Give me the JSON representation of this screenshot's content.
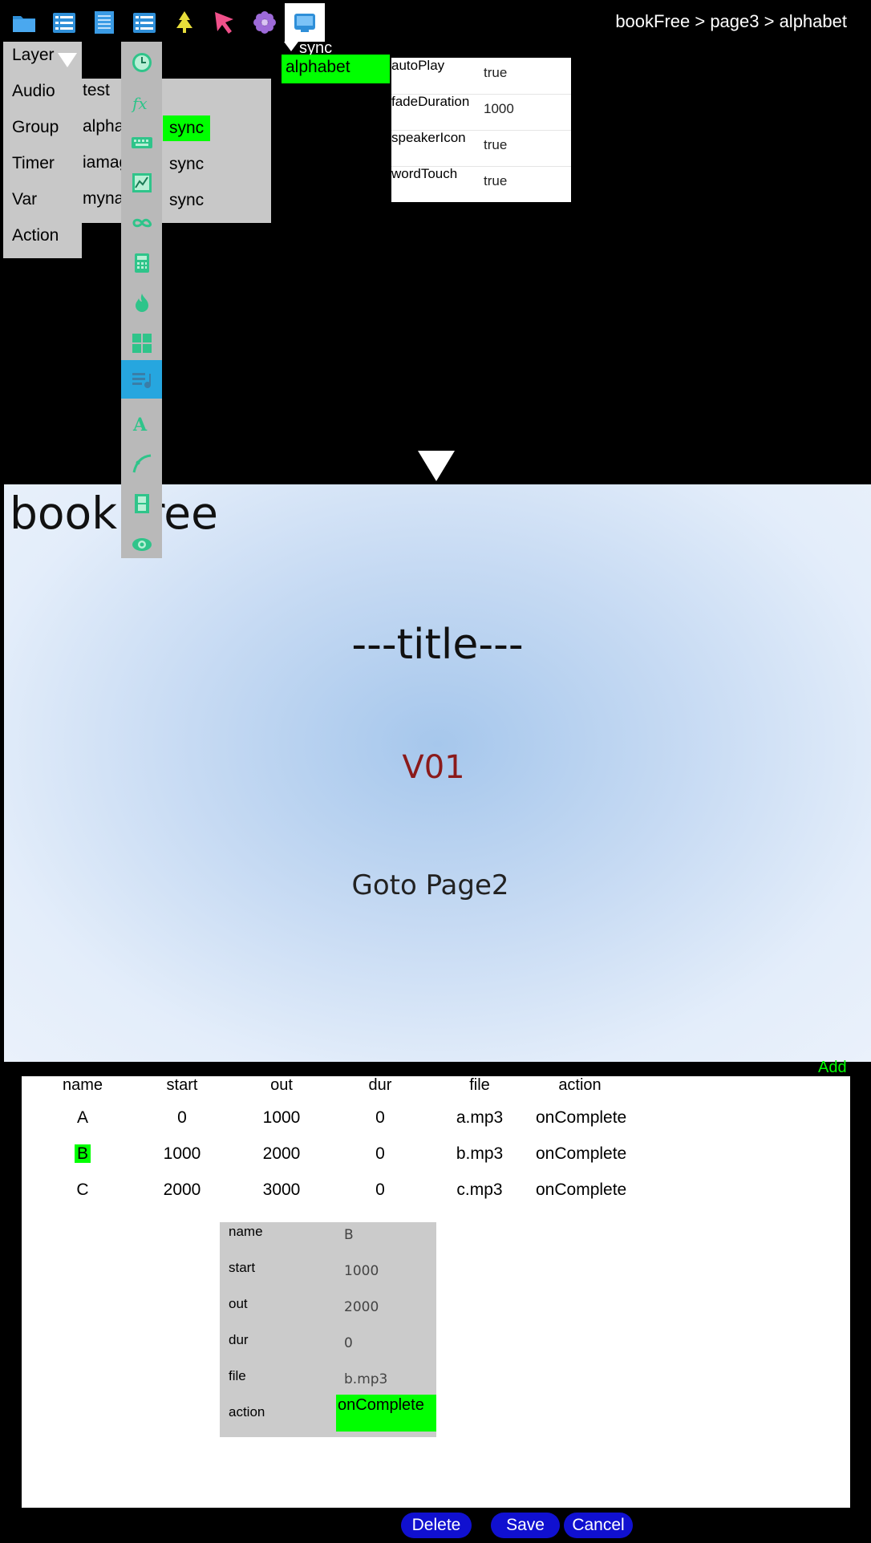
{
  "breadcrumb": "bookFree > page3 > alphabet",
  "toolbar": {
    "icons": [
      "folder-icon",
      "list-icon",
      "page-icon",
      "list-detail-icon",
      "tree-icon",
      "pointer-icon",
      "flower-icon",
      "media-icon"
    ],
    "active": "media-icon"
  },
  "layer_menu": [
    "Layer",
    "Audio",
    "Group",
    "Timer",
    "Var",
    "Action"
  ],
  "name_list": [
    "test",
    "alpha",
    "iamag",
    "myna"
  ],
  "sync_list": [
    "sync",
    "sync",
    "sync"
  ],
  "tool_icons": [
    "clock-icon",
    "function-icon",
    "keyboard-icon",
    "graph-icon",
    "infinity-icon",
    "calculator-icon",
    "fire-icon",
    "grid-icon",
    "sync-audio-icon",
    "text-icon",
    "curve-icon",
    "film-icon",
    "cloud-icon"
  ],
  "sync_caption": "sync",
  "selected_item": "alphabet",
  "properties": [
    {
      "key": "autoPlay",
      "value": "true"
    },
    {
      "key": "fadeDuration",
      "value": "1000"
    },
    {
      "key": "speakerIcon",
      "value": "true"
    },
    {
      "key": "wordTouch",
      "value": "true"
    }
  ],
  "stage": {
    "book_title": "book free",
    "title": "---title---",
    "version": "V01",
    "goto": "Goto Page2"
  },
  "add_label": "Add",
  "table": {
    "headers": [
      "name",
      "start",
      "out",
      "dur",
      "file",
      "action"
    ],
    "rows": [
      [
        "A",
        "0",
        "1000",
        "0",
        "a.mp3",
        "onComplete"
      ],
      [
        "B",
        "1000",
        "2000",
        "0",
        "b.mp3",
        "onComplete"
      ],
      [
        "C",
        "2000",
        "3000",
        "0",
        "c.mp3",
        "onComplete"
      ]
    ],
    "selected_row": 1
  },
  "detail": {
    "fields": [
      {
        "key": "name",
        "value": "B"
      },
      {
        "key": "start",
        "value": "1000"
      },
      {
        "key": "out",
        "value": "2000"
      },
      {
        "key": "dur",
        "value": "0"
      },
      {
        "key": "file",
        "value": "b.mp3"
      },
      {
        "key": "action",
        "value": "onComplete"
      }
    ]
  },
  "buttons": {
    "delete": "Delete",
    "save": "Save",
    "cancel": "Cancel"
  },
  "colors": {
    "highlight": "#00ff00",
    "pill": "#1010d0",
    "active_icon_bg": "#26a6df"
  }
}
